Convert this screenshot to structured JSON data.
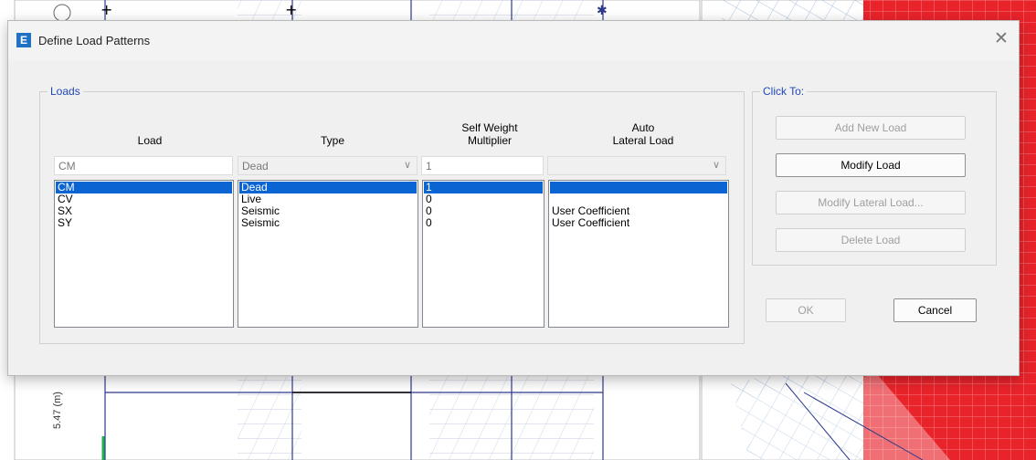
{
  "dialog": {
    "title": "Define Load Patterns",
    "app_icon_letter": "E",
    "close_glyph": "✕"
  },
  "background": {
    "elevation_label": "5.47 (m)"
  },
  "loads_group": {
    "legend": "Loads",
    "headers": {
      "load": "Load",
      "type": "Type",
      "self_weight": "Self Weight\nMultiplier",
      "auto_lateral": "Auto\nLateral Load"
    },
    "inputs": {
      "load_value": "CM",
      "type_value": "Dead",
      "self_weight_value": "1",
      "auto_lateral_value": ""
    },
    "rows": [
      {
        "load": "CM",
        "type": "Dead",
        "self_weight": "1",
        "auto_lateral": "",
        "selected": true
      },
      {
        "load": "CV",
        "type": "Live",
        "self_weight": "0",
        "auto_lateral": "",
        "selected": false
      },
      {
        "load": "SX",
        "type": "Seismic",
        "self_weight": "0",
        "auto_lateral": "User Coefficient",
        "selected": false
      },
      {
        "load": "SY",
        "type": "Seismic",
        "self_weight": "0",
        "auto_lateral": "User Coefficient",
        "selected": false
      }
    ]
  },
  "click_group": {
    "legend": "Click To:",
    "buttons": {
      "add_new": "Add New Load",
      "modify": "Modify Load",
      "modify_lateral": "Modify Lateral Load...",
      "delete": "Delete Load"
    }
  },
  "footer": {
    "ok": "OK",
    "cancel": "Cancel"
  },
  "icons": {
    "dropdown": "chevron-down-icon",
    "close": "close-icon",
    "app": "etabs-app-icon"
  },
  "colors": {
    "selection": "#0a64d2",
    "legend_text": "#1f47b8",
    "app_icon": "#1f72c4",
    "model_red": "#e8232a"
  }
}
